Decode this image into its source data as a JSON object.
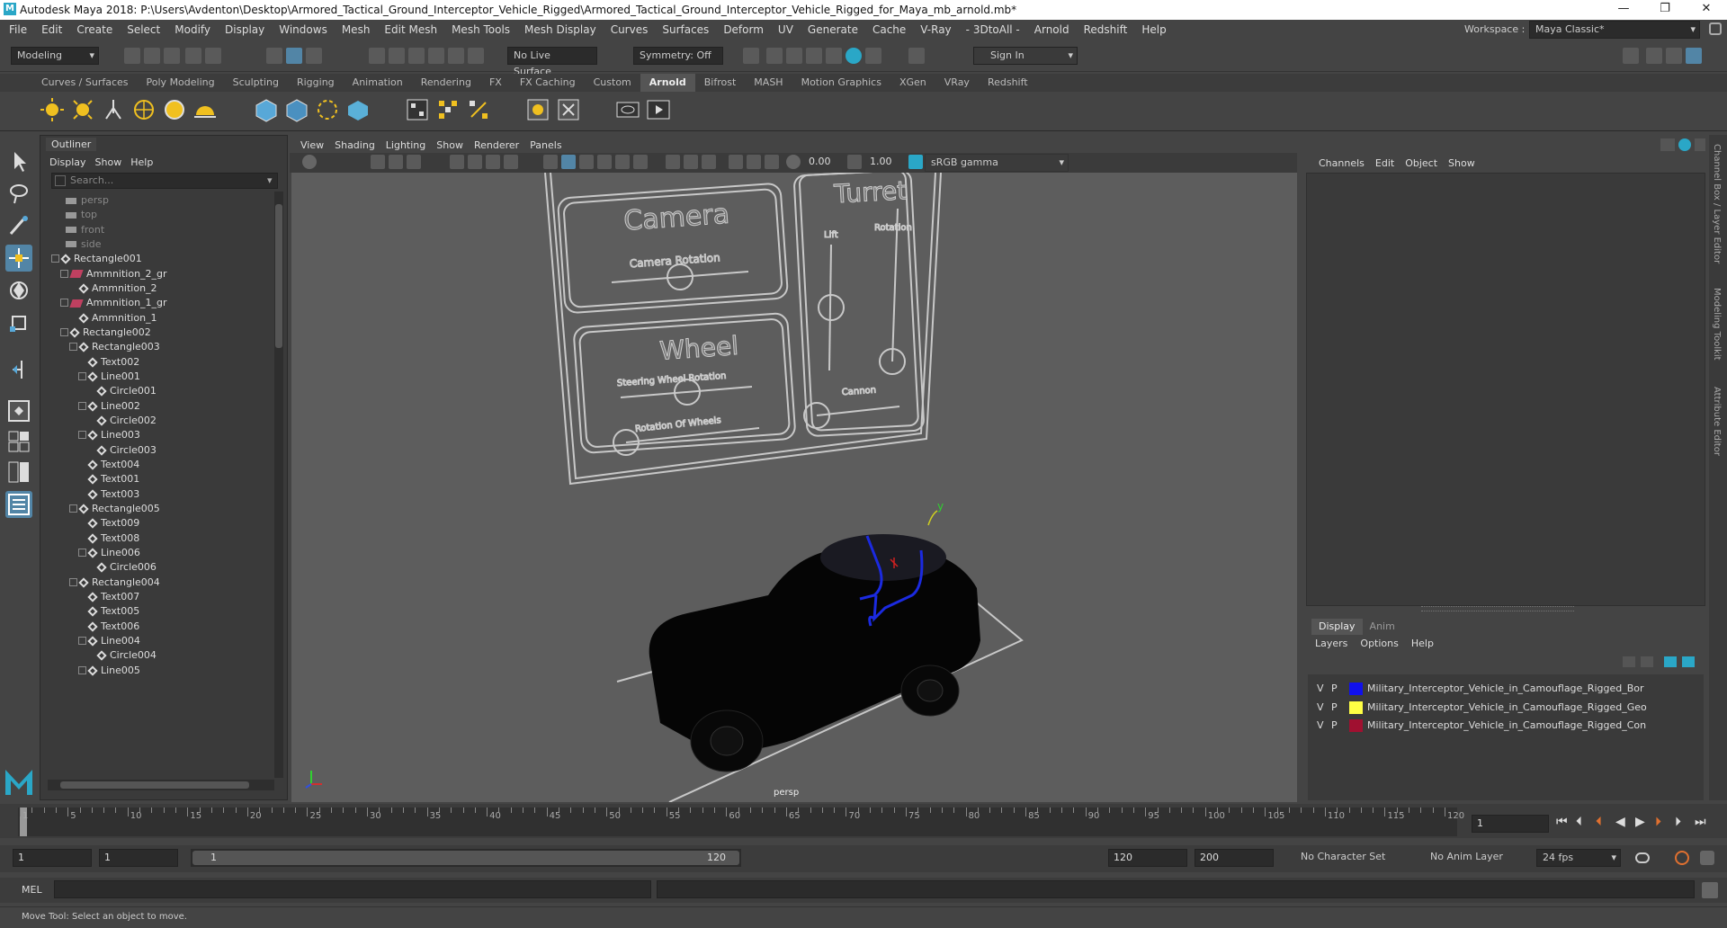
{
  "app": {
    "title": "Autodesk Maya 2018: P:\\Users\\Avdenton\\Desktop\\Armored_Tactical_Ground_Interceptor_Vehicle_Rigged\\Armored_Tactical_Ground_Interceptor_Vehicle_Rigged_for_Maya_mb_arnold.mb*",
    "minimize": "—",
    "maximize": "❐",
    "close": "✕"
  },
  "menubar": {
    "items": [
      "File",
      "Edit",
      "Create",
      "Select",
      "Modify",
      "Display",
      "Windows",
      "Mesh",
      "Edit Mesh",
      "Mesh Tools",
      "Mesh Display",
      "Curves",
      "Surfaces",
      "Deform",
      "UV",
      "Generate",
      "Cache",
      "V-Ray",
      "- 3DtoAll -",
      "Arnold",
      "Redshift",
      "Help"
    ],
    "workspace_label": "Workspace :",
    "workspace_value": "Maya Classic*"
  },
  "statusline": {
    "mode": "Modeling",
    "live_surface": "No Live Surface",
    "symmetry": "Symmetry: Off",
    "sign_in": "Sign In"
  },
  "shelf": {
    "tabs": [
      "Curves / Surfaces",
      "Poly Modeling",
      "Sculpting",
      "Rigging",
      "Animation",
      "Rendering",
      "FX",
      "FX Caching",
      "Custom",
      "Arnold",
      "Bifrost",
      "MASH",
      "Motion Graphics",
      "XGen",
      "VRay",
      "Redshift"
    ],
    "active_tab": "Arnold"
  },
  "outliner": {
    "title": "Outliner",
    "menu": [
      "Display",
      "Show",
      "Help"
    ],
    "search_placeholder": "Search...",
    "nodes": [
      {
        "label": "persp",
        "depth": 0,
        "kind": "camera"
      },
      {
        "label": "top",
        "depth": 0,
        "kind": "camera"
      },
      {
        "label": "front",
        "depth": 0,
        "kind": "camera"
      },
      {
        "label": "side",
        "depth": 0,
        "kind": "camera"
      },
      {
        "label": "Rectangle001",
        "depth": 0,
        "kind": "curve",
        "expander": "-"
      },
      {
        "label": "Ammnition_2_gr",
        "depth": 1,
        "kind": "group",
        "expander": "-"
      },
      {
        "label": "Ammnition_2",
        "depth": 2,
        "kind": "curve"
      },
      {
        "label": "Ammnition_1_gr",
        "depth": 1,
        "kind": "group",
        "expander": "-"
      },
      {
        "label": "Ammnition_1",
        "depth": 2,
        "kind": "curve"
      },
      {
        "label": "Rectangle002",
        "depth": 1,
        "kind": "curve",
        "expander": "-"
      },
      {
        "label": "Rectangle003",
        "depth": 2,
        "kind": "curve",
        "expander": "-"
      },
      {
        "label": "Text002",
        "depth": 3,
        "kind": "curve"
      },
      {
        "label": "Line001",
        "depth": 3,
        "kind": "curve",
        "expander": "-"
      },
      {
        "label": "Circle001",
        "depth": 4,
        "kind": "curve"
      },
      {
        "label": "Line002",
        "depth": 3,
        "kind": "curve",
        "expander": "-"
      },
      {
        "label": "Circle002",
        "depth": 4,
        "kind": "curve"
      },
      {
        "label": "Line003",
        "depth": 3,
        "kind": "curve",
        "expander": "-"
      },
      {
        "label": "Circle003",
        "depth": 4,
        "kind": "curve"
      },
      {
        "label": "Text004",
        "depth": 3,
        "kind": "curve"
      },
      {
        "label": "Text001",
        "depth": 3,
        "kind": "curve"
      },
      {
        "label": "Text003",
        "depth": 3,
        "kind": "curve"
      },
      {
        "label": "Rectangle005",
        "depth": 2,
        "kind": "curve",
        "expander": "-"
      },
      {
        "label": "Text009",
        "depth": 3,
        "kind": "curve"
      },
      {
        "label": "Text008",
        "depth": 3,
        "kind": "curve"
      },
      {
        "label": "Line006",
        "depth": 3,
        "kind": "curve",
        "expander": "-"
      },
      {
        "label": "Circle006",
        "depth": 4,
        "kind": "curve"
      },
      {
        "label": "Rectangle004",
        "depth": 2,
        "kind": "curve",
        "expander": "-"
      },
      {
        "label": "Text007",
        "depth": 3,
        "kind": "curve"
      },
      {
        "label": "Text005",
        "depth": 3,
        "kind": "curve"
      },
      {
        "label": "Text006",
        "depth": 3,
        "kind": "curve"
      },
      {
        "label": "Line004",
        "depth": 3,
        "kind": "curve",
        "expander": "-"
      },
      {
        "label": "Circle004",
        "depth": 4,
        "kind": "curve"
      },
      {
        "label": "Line005",
        "depth": 3,
        "kind": "curve",
        "expander": "-"
      }
    ]
  },
  "viewport": {
    "menu": [
      "View",
      "Shading",
      "Lighting",
      "Show",
      "Renderer",
      "Panels"
    ],
    "exposure": "0.00",
    "gamma": "1.00",
    "color_space": "sRGB gamma",
    "camera_label": "persp",
    "rig_texts": {
      "camera": "Camera",
      "camera_rotation": "Camera Rotation",
      "turret": "Turret",
      "lift": "Lift",
      "rotation": "Rotation",
      "wheel": "Wheel",
      "steering": "Steering Wheel Rotation",
      "rotation_wheels": "Rotation Of Wheels",
      "cannon": "Cannon"
    },
    "axis_y": "y"
  },
  "channelbox": {
    "menu": [
      "Channels",
      "Edit",
      "Object",
      "Show"
    ]
  },
  "layers": {
    "tabs": [
      "Display",
      "Anim"
    ],
    "menu": [
      "Layers",
      "Options",
      "Help"
    ],
    "items": [
      {
        "v": "V",
        "p": "P",
        "color": "#1010ee",
        "name": "Military_Interceptor_Vehicle_in_Camouflage_Rigged_Bor"
      },
      {
        "v": "V",
        "p": "P",
        "color": "#ffff44",
        "name": "Military_Interceptor_Vehicle_in_Camouflage_Rigged_Geo"
      },
      {
        "v": "V",
        "p": "P",
        "color": "#a01030",
        "name": "Military_Interceptor_Vehicle_in_Camouflage_Rigged_Con"
      }
    ]
  },
  "sidetabs": [
    "Channel Box / Layer Editor",
    "Modeling Toolkit",
    "Attribute Editor"
  ],
  "timeline": {
    "ticks": [
      "1",
      "5",
      "10",
      "15",
      "20",
      "25",
      "30",
      "35",
      "40",
      "45",
      "50",
      "55",
      "60",
      "65",
      "70",
      "75",
      "80",
      "85",
      "90",
      "95",
      "100",
      "105",
      "110",
      "115",
      "120"
    ],
    "current_frame": "1"
  },
  "range": {
    "start": "1",
    "playback_start": "1",
    "slider_start": "1",
    "slider_end": "120",
    "playback_end": "120",
    "end": "200",
    "character_set": "No Character Set",
    "anim_layer": "No Anim Layer",
    "fps": "24 fps"
  },
  "cmdline": {
    "lang": "MEL"
  },
  "helpline": {
    "text": "Move Tool: Select an object to move."
  }
}
